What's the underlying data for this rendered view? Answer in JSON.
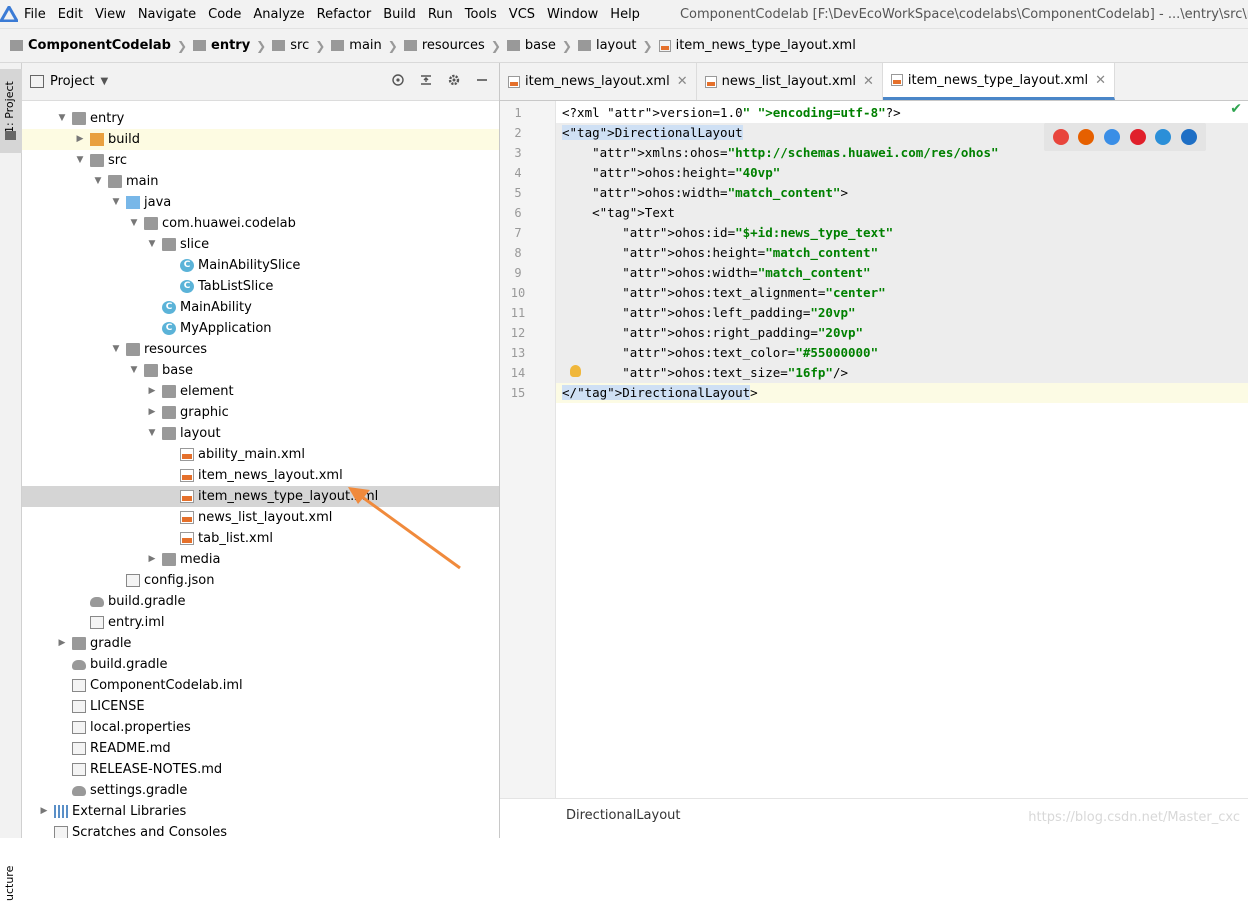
{
  "menubar": {
    "items": [
      "File",
      "Edit",
      "View",
      "Navigate",
      "Code",
      "Analyze",
      "Refactor",
      "Build",
      "Run",
      "Tools",
      "VCS",
      "Window",
      "Help"
    ],
    "window_title": "ComponentCodelab [F:\\DevEcoWorkSpace\\codelabs\\ComponentCodelab] - ...\\entry\\src\\main\\r"
  },
  "breadcrumb": [
    "ComponentCodelab",
    "entry",
    "src",
    "main",
    "resources",
    "base",
    "layout",
    "item_news_type_layout.xml"
  ],
  "side_strip": {
    "project_tab": "1: Project",
    "structure_tab": "ucture"
  },
  "project_panel": {
    "title": "Project"
  },
  "tree": [
    {
      "label": "entry",
      "depth": 1,
      "icon": "folder",
      "expanded": true
    },
    {
      "label": "build",
      "depth": 2,
      "icon": "folder-orange",
      "expanded": false
    },
    {
      "label": "src",
      "depth": 2,
      "icon": "folder",
      "expanded": true
    },
    {
      "label": "main",
      "depth": 3,
      "icon": "folder",
      "expanded": true
    },
    {
      "label": "java",
      "depth": 4,
      "icon": "folder-blue",
      "expanded": true
    },
    {
      "label": "com.huawei.codelab",
      "depth": 5,
      "icon": "folder",
      "expanded": true
    },
    {
      "label": "slice",
      "depth": 6,
      "icon": "folder",
      "expanded": true
    },
    {
      "label": "MainAbilitySlice",
      "depth": 7,
      "icon": "class"
    },
    {
      "label": "TabListSlice",
      "depth": 7,
      "icon": "class"
    },
    {
      "label": "MainAbility",
      "depth": 6,
      "icon": "class"
    },
    {
      "label": "MyApplication",
      "depth": 6,
      "icon": "class"
    },
    {
      "label": "resources",
      "depth": 4,
      "icon": "folder",
      "expanded": true
    },
    {
      "label": "base",
      "depth": 5,
      "icon": "folder",
      "expanded": true
    },
    {
      "label": "element",
      "depth": 6,
      "icon": "folder",
      "expanded": false
    },
    {
      "label": "graphic",
      "depth": 6,
      "icon": "folder",
      "expanded": false
    },
    {
      "label": "layout",
      "depth": 6,
      "icon": "folder",
      "expanded": true
    },
    {
      "label": "ability_main.xml",
      "depth": 7,
      "icon": "xml"
    },
    {
      "label": "item_news_layout.xml",
      "depth": 7,
      "icon": "xml"
    },
    {
      "label": "item_news_type_layout.xml",
      "depth": 7,
      "icon": "xml",
      "selected": true
    },
    {
      "label": "news_list_layout.xml",
      "depth": 7,
      "icon": "xml"
    },
    {
      "label": "tab_list.xml",
      "depth": 7,
      "icon": "xml"
    },
    {
      "label": "media",
      "depth": 6,
      "icon": "folder",
      "expanded": false
    },
    {
      "label": "config.json",
      "depth": 4,
      "icon": "file"
    },
    {
      "label": "build.gradle",
      "depth": 2,
      "icon": "gradle"
    },
    {
      "label": "entry.iml",
      "depth": 2,
      "icon": "file"
    },
    {
      "label": "gradle",
      "depth": 1,
      "icon": "folder",
      "expanded": false
    },
    {
      "label": "build.gradle",
      "depth": 1,
      "icon": "gradle"
    },
    {
      "label": "ComponentCodelab.iml",
      "depth": 1,
      "icon": "file"
    },
    {
      "label": "LICENSE",
      "depth": 1,
      "icon": "file"
    },
    {
      "label": "local.properties",
      "depth": 1,
      "icon": "file"
    },
    {
      "label": "README.md",
      "depth": 1,
      "icon": "file"
    },
    {
      "label": "RELEASE-NOTES.md",
      "depth": 1,
      "icon": "file"
    },
    {
      "label": "settings.gradle",
      "depth": 1,
      "icon": "gradle"
    },
    {
      "label": "External Libraries",
      "depth": 0,
      "icon": "lib",
      "expanded": false
    },
    {
      "label": "Scratches and Consoles",
      "depth": 0,
      "icon": "scratch"
    }
  ],
  "tabs": [
    {
      "label": "item_news_layout.xml",
      "active": false
    },
    {
      "label": "news_list_layout.xml",
      "active": false
    },
    {
      "label": "item_news_type_layout.xml",
      "active": true
    }
  ],
  "code_lines": [
    "<?xml version=\"1.0\" encoding=\"utf-8\"?>",
    "<DirectionalLayout",
    "    xmlns:ohos=\"http://schemas.huawei.com/res/ohos\"",
    "    ohos:height=\"40vp\"",
    "    ohos:width=\"match_content\">",
    "    <Text",
    "        ohos:id=\"$+id:news_type_text\"",
    "        ohos:height=\"match_content\"",
    "        ohos:width=\"match_content\"",
    "        ohos:text_alignment=\"center\"",
    "        ohos:left_padding=\"20vp\"",
    "        ohos:right_padding=\"20vp\"",
    "        ohos:text_color=\"#55000000\"",
    "        ohos:text_size=\"16fp\"/>",
    "</DirectionalLayout>"
  ],
  "browser_icons": [
    {
      "name": "chrome-icon",
      "color": "#e8453c"
    },
    {
      "name": "firefox-icon",
      "color": "#e66000"
    },
    {
      "name": "safari-icon",
      "color": "#3a8ee6"
    },
    {
      "name": "opera-icon",
      "color": "#e0202b"
    },
    {
      "name": "ie-icon",
      "color": "#2b8fd8"
    },
    {
      "name": "edge-icon",
      "color": "#1f6fc5"
    }
  ],
  "status": {
    "context": "DirectionalLayout",
    "watermark": "https://blog.csdn.net/Master_cxc"
  },
  "colors": {
    "accent": "#4a86c8",
    "selection": "#d5d5d5",
    "annotation_arrow": "#f08a3c"
  }
}
